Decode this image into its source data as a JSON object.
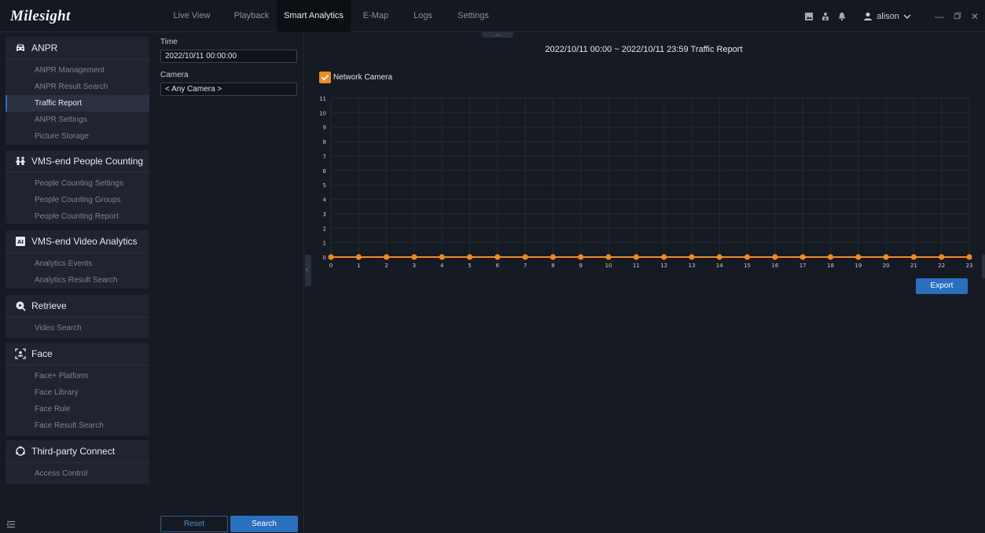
{
  "app": {
    "logo": "Milesight",
    "nav_tabs": [
      {
        "label": "Live View",
        "active": false
      },
      {
        "label": "Playback",
        "active": false
      },
      {
        "label": "Smart Analytics",
        "active": true
      },
      {
        "label": "E-Map",
        "active": false
      },
      {
        "label": "Logs",
        "active": false
      },
      {
        "label": "Settings",
        "active": false
      }
    ],
    "user_name": "alison",
    "icons": [
      "image-icon",
      "download-icon",
      "bell-icon",
      "user-icon",
      "chevron-down-icon",
      "minimize-icon",
      "restore-icon",
      "close-icon"
    ]
  },
  "sidebar": {
    "groups": [
      {
        "title": "ANPR",
        "icon": "car-icon",
        "items": [
          "ANPR Management",
          "ANPR Result Search",
          "Traffic Report",
          "ANPR Settings",
          "Picture Storage"
        ],
        "active_item": "Traffic Report"
      },
      {
        "title": "VMS-end People Counting",
        "icon": "people-icon",
        "items": [
          "People Counting Settings",
          "People Counting Groups",
          "People Counting Report"
        ]
      },
      {
        "title": "VMS-end Video Analytics",
        "icon": "ai-icon",
        "items": [
          "Analytics Events",
          "Analytics Result Search"
        ]
      },
      {
        "title": "Retrieve",
        "icon": "search-play-icon",
        "items": [
          "Video Search"
        ]
      },
      {
        "title": "Face",
        "icon": "face-scan-icon",
        "items": [
          "Face+ Platform",
          "Face Library",
          "Face Rule",
          "Face Result Search"
        ]
      },
      {
        "title": "Third-party Connect",
        "icon": "connect-icon",
        "items": [
          "Access Control"
        ]
      }
    ]
  },
  "filter": {
    "time_label": "Time",
    "time_value": "2022/10/11 00:00:00",
    "camera_label": "Camera",
    "camera_value": "< Any Camera >",
    "reset_label": "Reset",
    "search_label": "Search"
  },
  "report": {
    "title": "2022/10/11 00:00 ~ 2022/10/11 23:59 Traffic Report",
    "legend_label": "Network Camera",
    "export_label": "Export",
    "accent_color": "#f08a24"
  },
  "chart_data": {
    "type": "line",
    "x": [
      0,
      1,
      2,
      3,
      4,
      5,
      6,
      7,
      8,
      9,
      10,
      11,
      12,
      13,
      14,
      15,
      16,
      17,
      18,
      19,
      20,
      21,
      22,
      23
    ],
    "series": [
      {
        "name": "Network Camera",
        "values": [
          0,
          0,
          0,
          0,
          0,
          0,
          0,
          0,
          0,
          0,
          0,
          0,
          0,
          0,
          0,
          0,
          0,
          0,
          0,
          0,
          0,
          0,
          0,
          0
        ]
      }
    ],
    "ylim": [
      0,
      11
    ],
    "yticks": [
      0,
      1,
      2,
      3,
      4,
      5,
      6,
      7,
      8,
      9,
      10,
      11
    ],
    "grid": true,
    "legend_position": "top-left"
  }
}
